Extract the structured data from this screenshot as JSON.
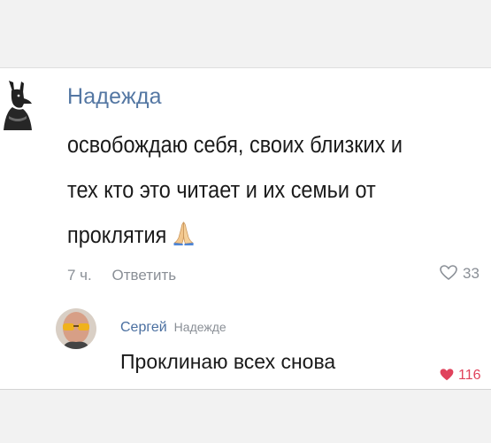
{
  "comment": {
    "author": "Надежда",
    "text_lines": [
      "освобождаю себя, своих близких и",
      "тех кто это читает и их семьи от",
      "проклятия"
    ],
    "emoji_icon": "praying-hands-icon",
    "time": "7 ч.",
    "reply_label": "Ответить",
    "likes": "33"
  },
  "reply": {
    "author": "Сергей",
    "reply_to": "Надежде",
    "text": "Проклинаю всех снова",
    "likes": "116"
  },
  "colors": {
    "author": "#5477a3",
    "meta": "#8a8f96",
    "liked_heart": "#e0425c"
  }
}
